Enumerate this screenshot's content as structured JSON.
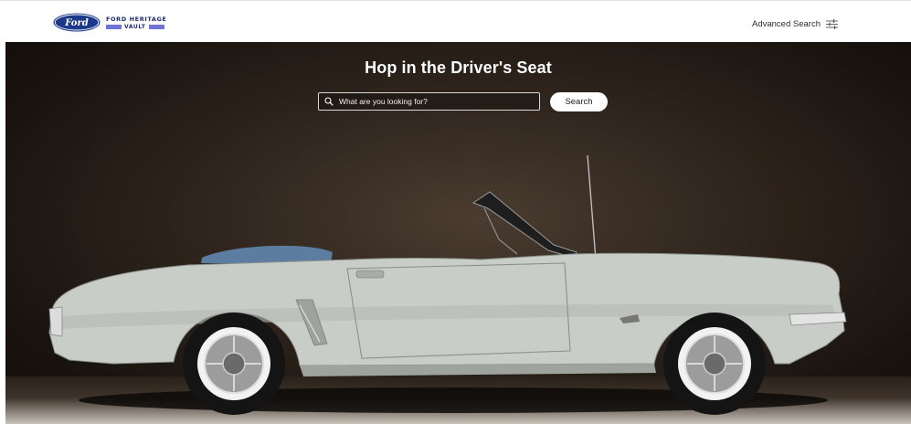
{
  "header": {
    "logo": {
      "brand": "Ford",
      "line1": "FORD HERITAGE",
      "line2": "VAULT",
      "oval_color": "#1d3a8a",
      "bar_color": "#6e74d6"
    },
    "advanced_search_label": "Advanced Search",
    "advanced_search_icon": "sliders-icon"
  },
  "hero": {
    "title": "Hop in the Driver's Seat",
    "search": {
      "value": "",
      "placeholder": "What are you looking for?",
      "icon": "search-icon"
    },
    "search_button_label": "Search",
    "image_subject": "vintage convertible car"
  },
  "colors": {
    "hero_background": "#2e241c",
    "car_body": "#c9cdc8",
    "header_background": "#ffffff"
  }
}
